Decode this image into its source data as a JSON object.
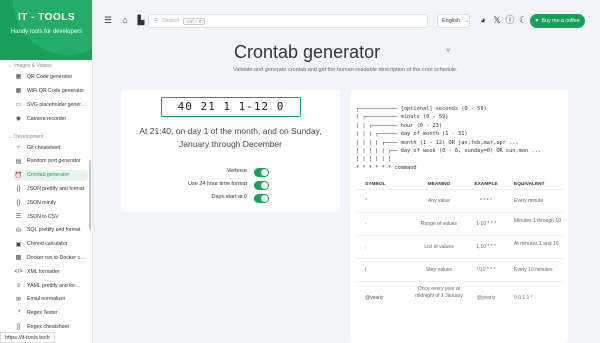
{
  "brand": {
    "title": "IT - TOOLS",
    "subtitle": "Handy tools for developers"
  },
  "sidebar": {
    "sections": [
      {
        "label": "Images & Videos"
      },
      {
        "label": "Development"
      }
    ],
    "images_items": [
      {
        "label": "QR Code generator",
        "icon": "qrcode-icon",
        "glyph": "▦"
      },
      {
        "label": "WiFi QR Code generator",
        "icon": "qrcode-icon",
        "glyph": "▦"
      },
      {
        "label": "SVG placeholder gener…",
        "icon": "image-icon",
        "glyph": "▭"
      },
      {
        "label": "Camera recorder",
        "icon": "camera-icon",
        "glyph": "◉"
      }
    ],
    "dev_items": [
      {
        "label": "Git cheatsheet",
        "icon": "git-icon",
        "glyph": "⑂"
      },
      {
        "label": "Random port generator",
        "icon": "server-icon",
        "glyph": "▤"
      },
      {
        "label": "Crontab generator",
        "icon": "alarm-icon",
        "glyph": "⏰"
      },
      {
        "label": "JSON prettify and format",
        "icon": "braces-icon",
        "glyph": "{}"
      },
      {
        "label": "JSON minify",
        "icon": "braces-icon",
        "glyph": "{}"
      },
      {
        "label": "JSON to CSV",
        "icon": "list-icon",
        "glyph": "☰"
      },
      {
        "label": "SQL prettify and format",
        "icon": "database-icon",
        "glyph": "⛁"
      },
      {
        "label": "Chmod calculator",
        "icon": "lock-icon",
        "glyph": "▣"
      },
      {
        "label": "Docker run to Docker c…",
        "icon": "docker-icon",
        "glyph": "▩"
      },
      {
        "label": "XML formatter",
        "icon": "code-icon",
        "glyph": "</>"
      },
      {
        "label": "YAML prettify and for…",
        "icon": "align-icon",
        "glyph": "≡"
      },
      {
        "label": "Email normalizer",
        "icon": "mail-icon",
        "glyph": "✉"
      },
      {
        "label": "Regex Tester",
        "icon": "regex-icon",
        "glyph": ".*"
      },
      {
        "label": "Regex cheatsheet",
        "icon": "brackets-icon",
        "glyph": "[]"
      }
    ],
    "active": "Crontab generator"
  },
  "status_url": "https://it-tools.tech",
  "topbar": {
    "search_placeholder": "Search",
    "search_shortcut": "Ctrl + K",
    "language": "English",
    "coffee": "Buy me a coffee"
  },
  "page": {
    "title": "Crontab generator",
    "description": "Validate and generate crontab and get the human-readable description of the cron schedule."
  },
  "cron": {
    "value": "40 21 1 1-12 0",
    "description": "At 21:40, on day 1 of the month, and on Sunday, January through December"
  },
  "options": [
    {
      "label": "Verbose",
      "on": true
    },
    {
      "label": "Use 24 hour time format",
      "on": true
    },
    {
      "label": "Days start at 0",
      "on": true
    }
  ],
  "help_lines": [
    "┌──────────── [optional] seconds (0 - 59)",
    "| ┌────────── minute (0 - 59)",
    "| | ┌──────── hour (0 - 23)",
    "| | | ┌────── day of month (1 - 31)",
    "| | | | ┌──── month (1 - 12) OR jan,feb,mar,apr ...",
    "| | | | | ┌── day of week (0 - 6, sunday=0) OR sun,mon ...",
    "| | | | | |",
    "* * * * * * command"
  ],
  "table": {
    "headers": [
      "SYMBOL",
      "MEANING",
      "EXAMPLE",
      "EQUIVALENT"
    ],
    "rows": [
      [
        "*",
        "Any value",
        "* * * *",
        "Every minute"
      ],
      [
        "-",
        "Range of values",
        "1-10 * * *",
        "Minutes 1 through 10"
      ],
      [
        ",",
        "List of values",
        "1,10 * * *",
        "At minutes 1 and 10"
      ],
      [
        "/",
        "Step values",
        "*/10 * * *",
        "Every 10 minutes"
      ],
      [
        "@yearly",
        "Once every year at midnight of 1 January",
        "@yearly",
        "0 0 1 1 *"
      ]
    ]
  }
}
